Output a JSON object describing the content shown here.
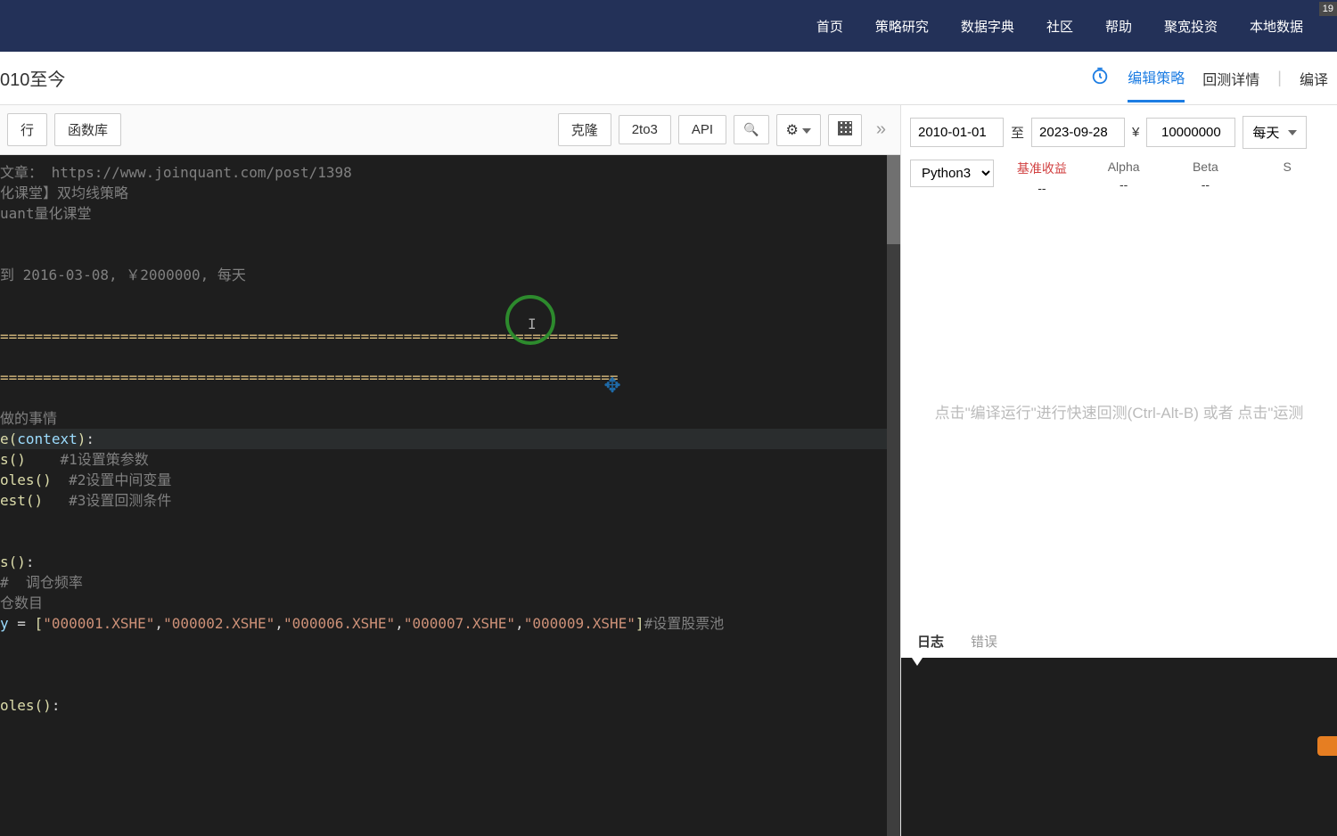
{
  "topNav": {
    "items": [
      "首页",
      "策略研究",
      "数据字典",
      "社区",
      "帮助",
      "聚宽投资",
      "本地数据"
    ],
    "badge": "19"
  },
  "subHeader": {
    "title": "010至今",
    "tabs": {
      "edit": "编辑策略",
      "backtest": "回测详情",
      "compile": "编译"
    }
  },
  "toolbar": {
    "left": {
      "run": "行",
      "funcLib": "函数库"
    },
    "right": {
      "clone": "克隆",
      "twoToThree": "2to3",
      "api": "API"
    }
  },
  "config": {
    "startDate": "2010-01-01",
    "toLabel": "至",
    "endDate": "2023-09-28",
    "currency": "¥",
    "amount": "10000000",
    "freq": "每天",
    "pythonVersion": "Python3"
  },
  "metrics": [
    {
      "label": "基准收益",
      "value": "--",
      "red": true
    },
    {
      "label": "Alpha",
      "value": "--"
    },
    {
      "label": "Beta",
      "value": "--"
    },
    {
      "label": "S",
      "value": ""
    }
  ],
  "hint": "点击\"编译运行\"进行快速回测(Ctrl-Alt-B) 或者 点击\"运测",
  "logTabs": {
    "log": "日志",
    "error": "错误"
  },
  "code": {
    "l1": "文章： https://www.joinquant.com/post/1398",
    "l2": "化课堂】双均线策略",
    "l3": "uant量化课堂",
    "l4": "到 2016-03-08, ￥2000000, 每天",
    "l5": "========================================================================",
    "l6": "========================================================================",
    "l7": "做的事情",
    "l8_func": "e",
    "l8_param": "context",
    "l9_func": "s",
    "l9_comment": "#1设置策参数",
    "l10_func": "oles",
    "l10_comment": "#2设置中间变量",
    "l11_func": "est",
    "l11_comment": "#3设置回测条件",
    "l12_func": "s",
    "l13_comment": "#  调仓频率",
    "l14": "仓数目",
    "l15_var": "y",
    "l15_eq": " = ",
    "l15_s1": "\"000001.XSHE\"",
    "l15_s2": "\"000002.XSHE\"",
    "l15_s3": "\"000006.XSHE\"",
    "l15_s4": "\"000007.XSHE\"",
    "l15_s5": "\"000009.XSHE\"",
    "l15_comment": "#设置股票池",
    "l16_func": "oles",
    "colon": ":",
    "paren_open": "(",
    "paren_close": ")",
    "bracket_open": "[",
    "bracket_close": "]",
    "comma": ","
  }
}
